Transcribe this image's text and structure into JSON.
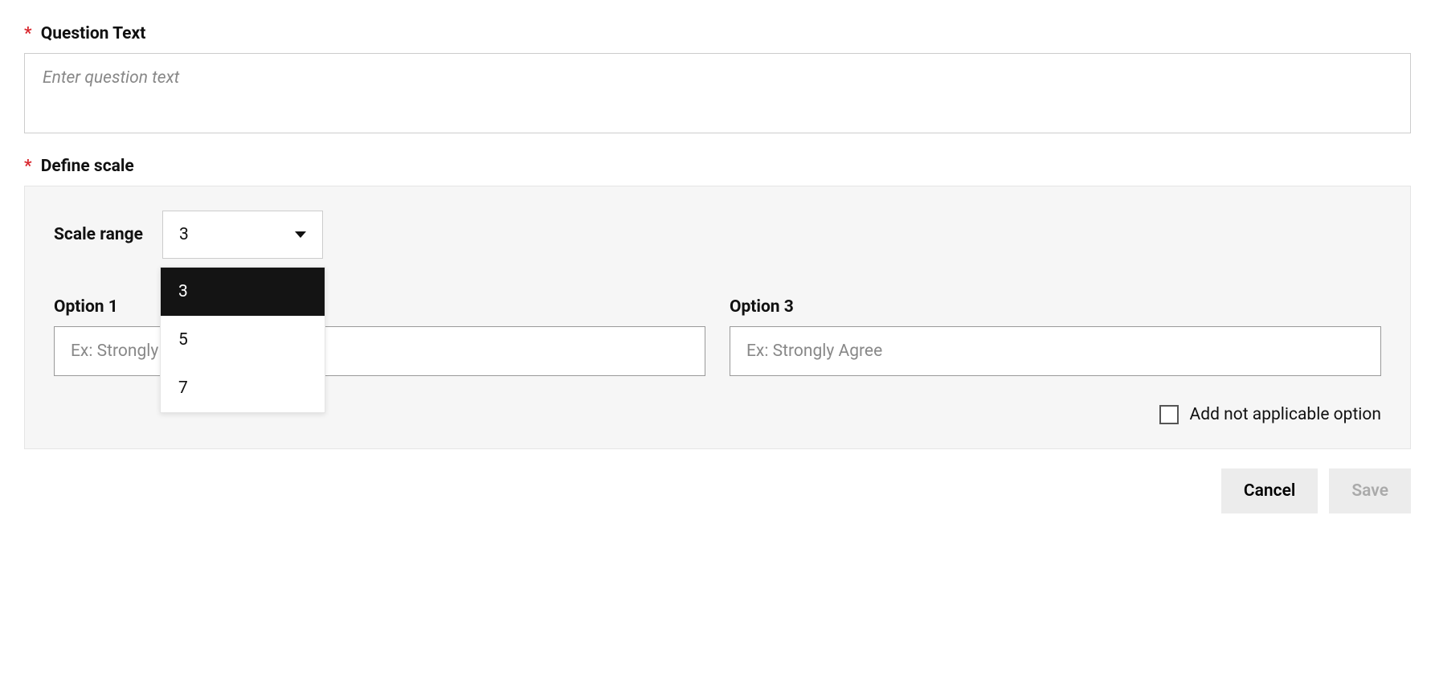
{
  "question": {
    "label": "Question Text",
    "placeholder": "Enter question text",
    "value": ""
  },
  "scale": {
    "label": "Define scale",
    "range_label": "Scale range",
    "selected": "3",
    "options": [
      "3",
      "5",
      "7"
    ]
  },
  "option_fields": [
    {
      "label": "Option 1",
      "placeholder": "Ex: Strongly Disagree",
      "value": ""
    },
    {
      "label": "Option 3",
      "placeholder": "Ex: Strongly Agree",
      "value": ""
    }
  ],
  "na_checkbox": {
    "label": "Add not applicable option",
    "checked": false
  },
  "buttons": {
    "cancel": "Cancel",
    "save": "Save"
  },
  "required_marker": "*"
}
